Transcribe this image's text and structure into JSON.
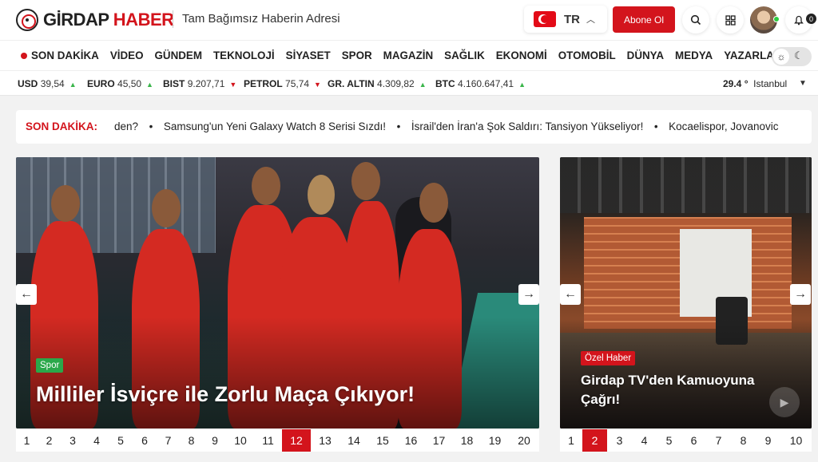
{
  "header": {
    "logo_part1": "GİRDAP",
    "logo_part2": "HABER",
    "tagline": "Tam Bağımsız Haberin Adresi",
    "language_code": "TR",
    "subscribe_label": "Abone Ol",
    "notification_count": "0"
  },
  "nav": {
    "live_label": "SON DAKİKA",
    "items": [
      "VİDEO",
      "GÜNDEM",
      "TEKNOLOJİ",
      "SİYASET",
      "SPOR",
      "MAGAZİN",
      "SAĞLIK",
      "EKONOMİ",
      "OTOMOBİL",
      "DÜNYA",
      "MEDYA",
      "YAZARLAR"
    ]
  },
  "markets": [
    {
      "name": "USD",
      "value": "39,54",
      "trend": "up"
    },
    {
      "name": "EURO",
      "value": "45,50",
      "trend": "up"
    },
    {
      "name": "BIST",
      "value": "9.207,71",
      "trend": "down"
    },
    {
      "name": "PETROL",
      "value": "75,74",
      "trend": "down"
    },
    {
      "name": "GR. ALTIN",
      "value": "4.309,82",
      "trend": "up"
    },
    {
      "name": "BTC",
      "value": "4.160.647,41",
      "trend": "up"
    }
  ],
  "weather": {
    "temp": "29.4 °",
    "city": "Istanbul"
  },
  "breaking": {
    "label": "SON DAKİKA:",
    "items": [
      "den?",
      "Samsung'un Yeni Galaxy Watch 8 Serisi Sızdı!",
      "İsrail'den İran'a Şok Saldırı: Tansiyon Yükseliyor!",
      "Kocaelispor, Jovanovic"
    ]
  },
  "main_slider": {
    "category": "Spor",
    "headline": "Milliler İsviçre ile Zorlu Maça Çıkıyor!",
    "pages": [
      "1",
      "2",
      "3",
      "4",
      "5",
      "6",
      "7",
      "8",
      "9",
      "10",
      "11",
      "12",
      "13",
      "14",
      "15",
      "16",
      "17",
      "18",
      "19",
      "20"
    ],
    "active_page": "12"
  },
  "side_slider": {
    "category": "Özel Haber",
    "headline": "Girdap TV'den Kamuoyuna Çağrı!",
    "pages": [
      "1",
      "2",
      "3",
      "4",
      "5",
      "6",
      "7",
      "8",
      "9",
      "10"
    ],
    "active_page": "2"
  },
  "colors": {
    "brand": "#d3141c",
    "up": "#3ab54a",
    "down": "#d3141c",
    "tag_spor": "#2aa84a"
  }
}
